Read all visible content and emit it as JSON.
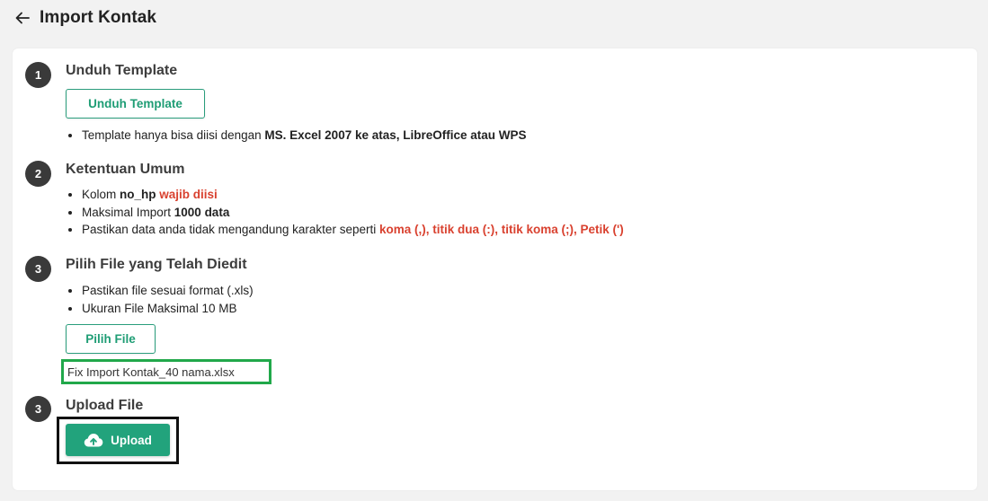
{
  "header": {
    "title": "Import Kontak",
    "back_icon": "arrow-left-icon"
  },
  "step1": {
    "number": "1",
    "title": "Unduh Template",
    "button_label": "Unduh Template",
    "note_text": "Template hanya bisa diisi dengan ",
    "note_bold": "MS. Excel 2007 ke atas, LibreOffice atau WPS"
  },
  "step2": {
    "number": "2",
    "title": "Ketentuan Umum",
    "rule1_text": "Kolom ",
    "rule1_bold": "no_hp",
    "rule1_red": "wajib diisi",
    "rule2_text": "Maksimal Import ",
    "rule2_bold": "1000 data",
    "rule3_text": "Pastikan data anda tidak mengandung karakter seperti ",
    "rule3_red": "koma (,), titik dua (:), titik koma (;), Petik (')"
  },
  "step3": {
    "number": "3",
    "title": "Pilih File yang Telah Diedit",
    "rule1": "Pastikan file sesuai format (.xls)",
    "rule2": "Ukuran File Maksimal 10 MB",
    "button_label": "Pilih File",
    "selected_file": "Fix Import Kontak_40 nama.xlsx"
  },
  "step4": {
    "number": "3",
    "title": "Upload File",
    "button_label": "Upload",
    "button_icon": "cloud-upload-icon"
  },
  "colors": {
    "accent": "#22a37c",
    "warning": "#d9412f",
    "highlight_green": "#21a84a"
  }
}
